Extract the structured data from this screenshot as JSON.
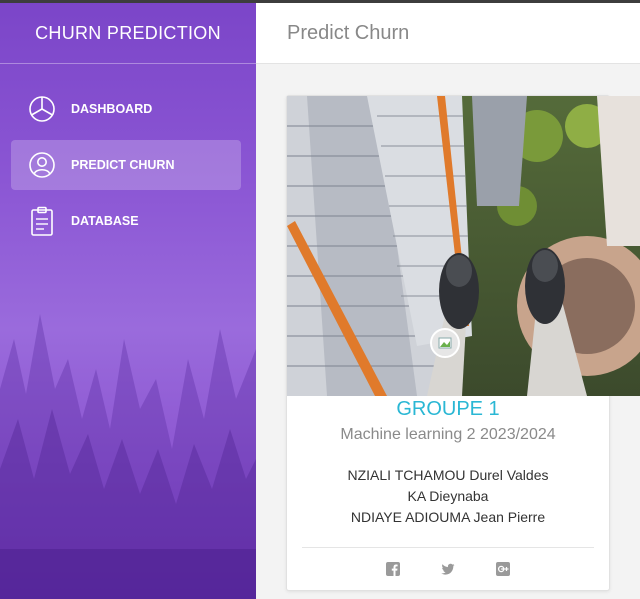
{
  "app": {
    "brand": "CHURN PREDICTION"
  },
  "sidebar": {
    "items": [
      {
        "label": "DASHBOARD",
        "icon": "pie-chart-icon",
        "active": false
      },
      {
        "label": "PREDICT CHURN",
        "icon": "user-circle-icon",
        "active": true
      },
      {
        "label": "DATABASE",
        "icon": "clipboard-icon",
        "active": false
      }
    ]
  },
  "header": {
    "title": "Predict Churn"
  },
  "card": {
    "group": "GROUPE 1",
    "subtitle": "Machine learning 2 2023/2024",
    "members": [
      "NZIALI TCHAMOU Durel Valdes",
      "KA Dieynaba",
      "NDIAYE ADIOUMA Jean Pierre"
    ],
    "social": [
      "facebook-icon",
      "twitter-icon",
      "google-plus-icon"
    ]
  },
  "colors": {
    "sidebar": "#8a53cf",
    "accent": "#2ab7d4",
    "header_bg": "#ffffff",
    "page_bg": "#f3f3f3"
  }
}
